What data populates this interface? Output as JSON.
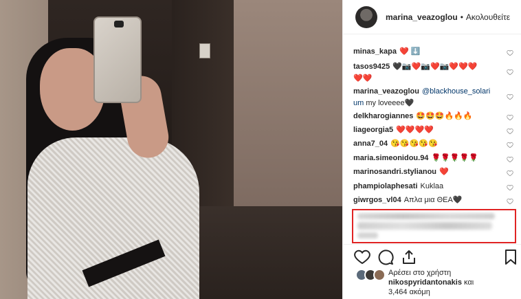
{
  "post": {
    "username": "marina_veazoglou",
    "separator": "•",
    "follow_label": "Ακολουθείτε"
  },
  "comments": [
    {
      "user": "minas_kapa",
      "text": "❤️ ⬇️"
    },
    {
      "user": "tasos9425",
      "text": "🖤📷❤️📷❤️📷❤️❤️❤️",
      "text2": "❤️❤️"
    },
    {
      "user": "marina_veazoglou",
      "mention": "@blackhouse_solari",
      "mention2": "um",
      "text": "my loveeee🖤"
    },
    {
      "user": "delkharogiannes",
      "text": "🤩🤩🤩🔥🔥🔥"
    },
    {
      "user": "liageorgia5",
      "text": "❤️❤️❤️❤️"
    },
    {
      "user": "anna7_04",
      "text": "😘😘😘😘😘"
    },
    {
      "user": "maria.simeonidou.94",
      "text": "🌹🌹🌹🌹🌹"
    },
    {
      "user": "marinosandri.stylianou",
      "text": "❤️"
    },
    {
      "user": "phampiolaphesati",
      "text": "Kuklaa"
    },
    {
      "user": "giwrgos_vl04",
      "text": "Απλα μια ΘΕΑ🖤"
    }
  ],
  "likes": {
    "line1": "Αρέσει στο χρήστη",
    "user": "nikospyridantonakis",
    "and": "και",
    "count_text": "3,464 ακόμη"
  },
  "icons": {
    "heart": "heart-outline-icon",
    "comment": "comment-icon",
    "share": "share-icon",
    "bookmark": "bookmark-icon"
  },
  "colors": {
    "highlight_box": "#e02323",
    "mention": "#003569"
  }
}
